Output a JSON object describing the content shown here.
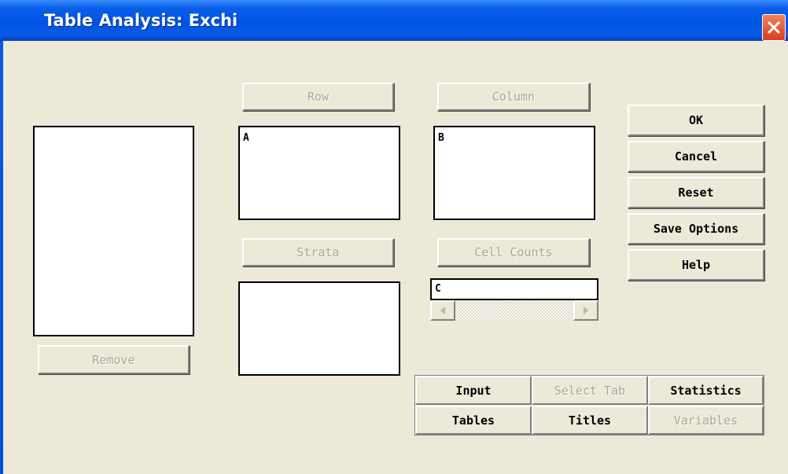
{
  "window": {
    "title": "Table Analysis: Exchi"
  },
  "variables_list": {
    "items": []
  },
  "buttons": {
    "remove": "Remove",
    "row": "Row",
    "column": "Column",
    "strata": "Strata",
    "cell_counts": "Cell Counts",
    "ok": "OK",
    "cancel": "Cancel",
    "reset": "Reset",
    "save_options": "Save Options",
    "help": "Help"
  },
  "row_list": {
    "items": [
      "A"
    ]
  },
  "column_list": {
    "items": [
      "B"
    ]
  },
  "strata_list": {
    "items": []
  },
  "cell_counts_field": {
    "value": "C"
  },
  "tabs": [
    {
      "label": "Input",
      "enabled": true
    },
    {
      "label": "Select Tab",
      "enabled": false
    },
    {
      "label": "Statistics",
      "enabled": true
    },
    {
      "label": "Tables",
      "enabled": true
    },
    {
      "label": "Titles",
      "enabled": true
    },
    {
      "label": "Variables",
      "enabled": false
    }
  ],
  "icons": {
    "close": "close-icon",
    "scroll_left": "arrow-left-icon",
    "scroll_right": "arrow-right-icon"
  },
  "colors": {
    "titlebar": "#0054e3",
    "close": "#d6401c",
    "dialog_bg": "#ece9d8",
    "disabled_text": "#a8a598"
  }
}
